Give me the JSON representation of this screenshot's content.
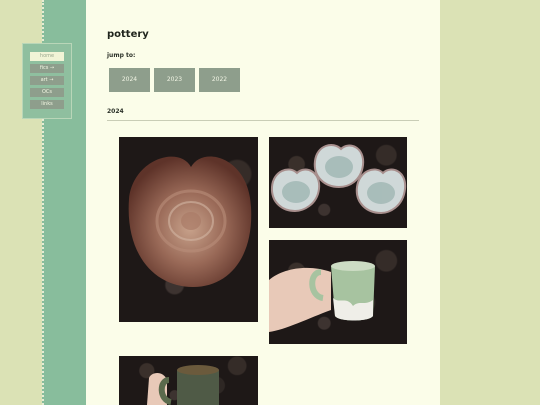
{
  "nav": {
    "items": [
      {
        "label": "home",
        "active": true
      },
      {
        "label": "fics →",
        "active": false
      },
      {
        "label": "art →",
        "active": false
      },
      {
        "label": "OCs",
        "active": false
      },
      {
        "label": "links",
        "active": false
      }
    ]
  },
  "page": {
    "title": "pottery",
    "jump_label": "jump to:",
    "year_buttons": [
      "2024",
      "2023",
      "2022"
    ],
    "section_heading": "2024"
  },
  "colors": {
    "background": "#dbe2b5",
    "side_strip": "#88bd9c",
    "content_bg": "#fbfde9",
    "button": "#8e9e8c"
  }
}
